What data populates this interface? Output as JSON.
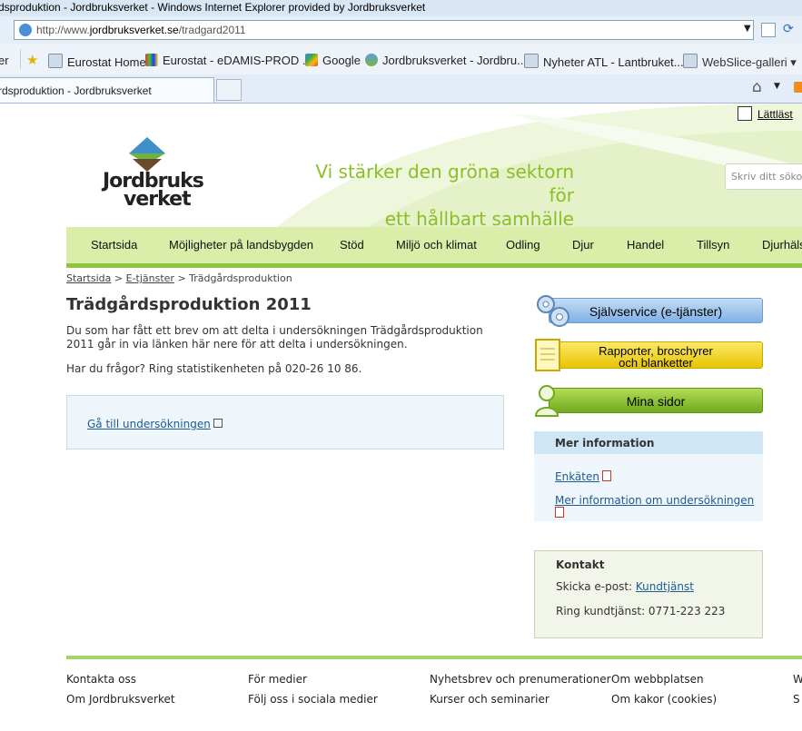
{
  "browser": {
    "window_title": "dsproduktion - Jordbruksverket - Windows Internet Explorer provided by Jordbruksverket",
    "url_prefix": "http://www.",
    "url_domain": "jordbruksverket.se",
    "url_path": "/tradgard2011",
    "favorites": [
      {
        "label": "er"
      },
      {
        "label": "Eurostat Home"
      },
      {
        "label": "Eurostat - eDAMIS-PROD ..."
      },
      {
        "label": "Google"
      },
      {
        "label": "Jordbruksverket - Jordbru..."
      },
      {
        "label": "Nyheter  ATL - Lantbruket..."
      },
      {
        "label": "WebSlice-galleri ▾"
      }
    ],
    "active_tab": "rdsproduktion - Jordbruksverket"
  },
  "page": {
    "lattlast": "Lättläst",
    "logo_line1": "Jordbruks",
    "logo_line2": "verket",
    "slogan_line1": "Vi stärker den gröna sektorn för",
    "slogan_line2": "ett hållbart samhälle",
    "search_placeholder": "Skriv ditt sökord",
    "nav": [
      "Startsida",
      "Möjligheter på landsbygden",
      "Stöd",
      "Miljö och klimat",
      "Odling",
      "Djur",
      "Handel",
      "Tillsyn",
      "Djurhäls"
    ],
    "breadcrumb": {
      "home": "Startsida",
      "sep1": ">",
      "eservices": "E-tjänster",
      "sep2": ">",
      "current": "Trädgårdsproduktion"
    },
    "title": "Trädgårdsproduktion 2011",
    "intro": "Du som har fått ett brev om att delta i undersökningen Trädgårdsproduktion 2011 går in via länken här nere för att delta i undersökningen.",
    "question": "Har du frågor? Ring statistikenheten på 020-26 10 86.",
    "survey_link": "Gå till undersökningen",
    "side_buttons": {
      "self_service": "Självservice (e-tjänster)",
      "reports_line1": "Rapporter, broschyrer",
      "reports_line2": "och blanketter",
      "my_pages": "Mina sidor"
    },
    "more_info": {
      "heading": "Mer information",
      "link1": "Enkäten",
      "link2": "Mer information om undersökningen"
    },
    "contact": {
      "heading": "Kontakt",
      "email_label": "Skicka e-post:",
      "email_link": "Kundtjänst",
      "phone": "Ring kundtjänst: 0771-223 223"
    },
    "footer": [
      [
        "Kontakta oss",
        "Om Jordbruksverket"
      ],
      [
        "För medier",
        "Följ oss i sociala medier"
      ],
      [
        "Nyhetsbrev och prenumerationer",
        "Kurser och seminarier"
      ],
      [
        "Om webbplatsen",
        "Om kakor (cookies)"
      ],
      [
        "W",
        "S"
      ]
    ]
  }
}
